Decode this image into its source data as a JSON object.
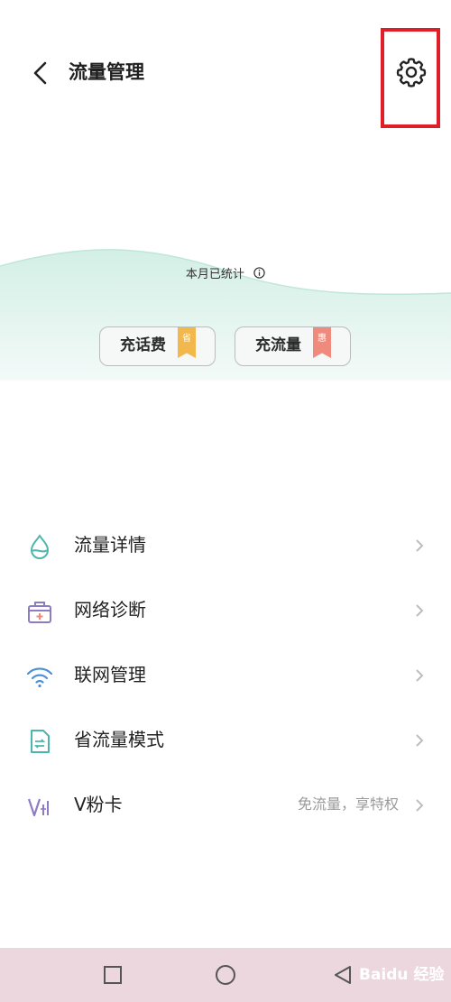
{
  "header": {
    "title": "流量管理",
    "back_icon": "chevron-left-icon",
    "settings_icon": "gear-icon"
  },
  "annotation": {
    "highlight_color": "#e01e2a"
  },
  "stats": {
    "label": "本月已统计",
    "info_icon": "info-icon"
  },
  "actions": [
    {
      "label": "充话费",
      "tag": "省",
      "tag_color": "#f2b84b"
    },
    {
      "label": "充流量",
      "tag": "惠",
      "tag_color": "#ef8a7d"
    }
  ],
  "menu": [
    {
      "label": "流量详情",
      "icon": "water-drop-icon",
      "sub": ""
    },
    {
      "label": "网络诊断",
      "icon": "medical-kit-icon",
      "sub": ""
    },
    {
      "label": "联网管理",
      "icon": "wifi-icon",
      "sub": ""
    },
    {
      "label": "省流量模式",
      "icon": "data-saver-file-icon",
      "sub": ""
    },
    {
      "label": "V粉卡",
      "icon": "vfan-card-icon",
      "sub": "免流量，享特权"
    }
  ],
  "navbar": {
    "background": "#ecd7de",
    "buttons": [
      "recent-apps-icon",
      "home-icon",
      "back-triangle-icon"
    ]
  },
  "watermark": {
    "text": "Baidu 经验"
  },
  "colors": {
    "wave_accent": "#bfe6dc",
    "icon_teal": "#4db6ac",
    "icon_purple": "#8e7cc3"
  }
}
